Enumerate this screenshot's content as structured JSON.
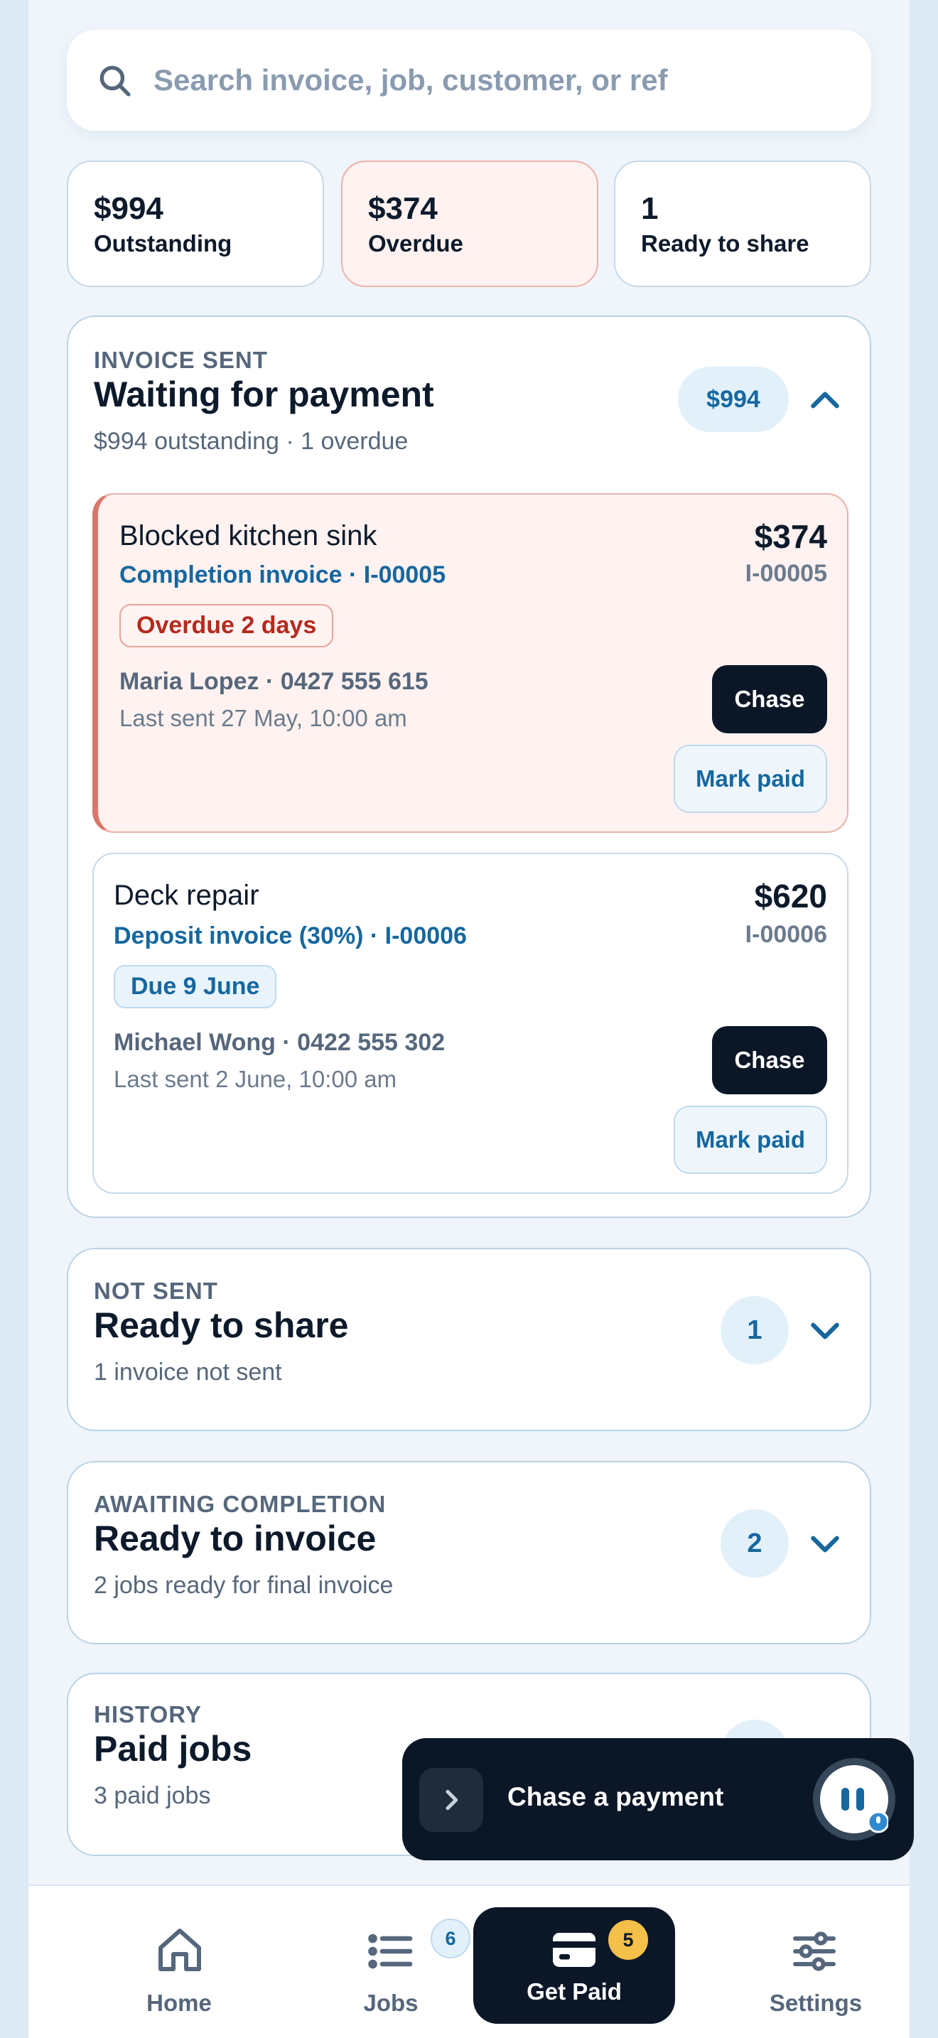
{
  "search": {
    "placeholder": "Search invoice, job, customer, or ref"
  },
  "stats": [
    {
      "value": "$994",
      "label": "Outstanding"
    },
    {
      "value": "$374",
      "label": "Overdue"
    },
    {
      "value": "1",
      "label": "Ready to share"
    }
  ],
  "sections": {
    "waiting": {
      "kicker": "INVOICE SENT",
      "title": "Waiting for payment",
      "subtitle": "$994 outstanding · 1 overdue",
      "pill": "$994",
      "invoices": [
        {
          "title": "Blocked kitchen sink",
          "subtitle": "Completion invoice · I-00005",
          "amount": "$374",
          "ref": "I-00005",
          "badge": "Overdue 2 days",
          "customer": "Maria Lopez · 0427 555 615",
          "sent": "Last sent 27 May, 10:00 am",
          "chase": "Chase",
          "mark_paid": "Mark paid"
        },
        {
          "title": "Deck repair",
          "subtitle": "Deposit invoice (30%) · I-00006",
          "amount": "$620",
          "ref": "I-00006",
          "badge": "Due 9 June",
          "customer": "Michael Wong · 0422 555 302",
          "sent": "Last sent 2 June, 10:00 am",
          "chase": "Chase",
          "mark_paid": "Mark paid"
        }
      ]
    },
    "not_sent": {
      "kicker": "NOT SENT",
      "title": "Ready to share",
      "subtitle": "1 invoice not sent",
      "pill": "1"
    },
    "awaiting": {
      "kicker": "AWAITING COMPLETION",
      "title": "Ready to invoice",
      "subtitle": "2 jobs ready for final invoice",
      "pill": "2"
    },
    "history": {
      "kicker": "HISTORY",
      "title": "Paid jobs",
      "subtitle": "3 paid jobs"
    }
  },
  "fab": {
    "label": "Chase a payment"
  },
  "nav": {
    "items": [
      {
        "label": "Home",
        "icon": "home-icon"
      },
      {
        "label": "Jobs",
        "icon": "list-icon",
        "badge": "6"
      },
      {
        "label": "Get Paid",
        "icon": "wallet-icon",
        "badge": "5"
      },
      {
        "label": "Settings",
        "icon": "sliders-icon"
      }
    ]
  },
  "colors": {
    "accent": "#16679e",
    "dark": "#0b1727",
    "overdue": "#b52a1e",
    "badge_yellow": "#f5c04a"
  }
}
